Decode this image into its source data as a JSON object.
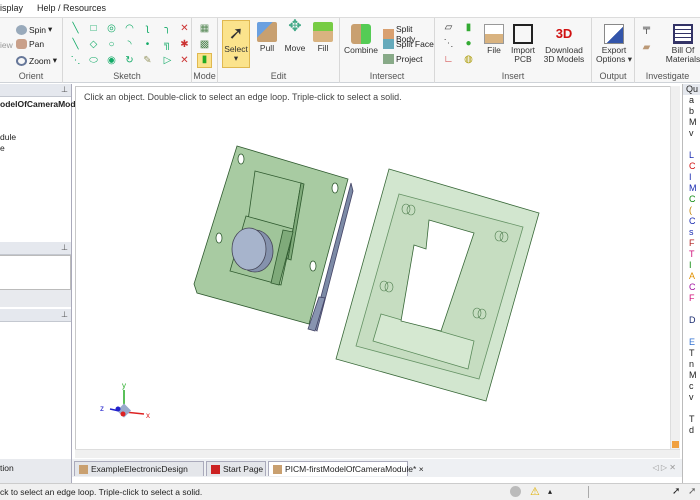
{
  "menu": {
    "items": [
      "isplay",
      "Help / Resources"
    ]
  },
  "ribbon": {
    "orient": {
      "label": "Orient",
      "spin": "Spin",
      "pan": "Pan",
      "zoom": "Zoom",
      "view": "iew"
    },
    "sketch": {
      "label": "Sketch"
    },
    "mode": {
      "label": "Mode"
    },
    "edit": {
      "label": "Edit",
      "select": "Select",
      "pull": "Pull",
      "move": "Move",
      "fill": "Fill"
    },
    "intersect": {
      "label": "Intersect",
      "combine": "Combine",
      "split_body": "Split Body",
      "split_face": "Split Face",
      "project": "Project"
    },
    "insert": {
      "label": "Insert",
      "file": "File",
      "import_pcb": "Import PCB",
      "download_3d": "Download 3D Models",
      "logo_3d": "3D"
    },
    "output": {
      "label": "Output",
      "export_options": "Export Options"
    },
    "investigate": {
      "label": "Investigate",
      "bom": "Bill Of Materials"
    }
  },
  "left_panel": {
    "tree_root": "odelOfCameraModul",
    "tree_items": [
      "dule",
      "e"
    ],
    "bottom_label": "tion"
  },
  "viewport": {
    "hint": "Click an object. Double-click to select an edge loop. Triple-click to select a solid.",
    "axes": {
      "x": "x",
      "y": "y",
      "z": "z"
    }
  },
  "right_panel": {
    "header": "Qu",
    "lines": [
      {
        "t": "a",
        "c": "#222"
      },
      {
        "t": "b",
        "c": "#222"
      },
      {
        "t": "M",
        "c": "#222"
      },
      {
        "t": "v",
        "c": "#222"
      },
      {
        "t": "",
        "c": "#222"
      },
      {
        "t": "L",
        "c": "#1a2bb0"
      },
      {
        "t": "C",
        "c": "#d01010"
      },
      {
        "t": "I",
        "c": "#1a2bb0"
      },
      {
        "t": "M",
        "c": "#1a2bb0"
      },
      {
        "t": "C",
        "c": "#108a10"
      },
      {
        "t": "(",
        "c": "#c08000"
      },
      {
        "t": "C",
        "c": "#1a2bb0"
      },
      {
        "t": "s",
        "c": "#1a2bb0"
      },
      {
        "t": "F",
        "c": "#b02020"
      },
      {
        "t": "T",
        "c": "#d0107a"
      },
      {
        "t": "I",
        "c": "#108a10"
      },
      {
        "t": "A",
        "c": "#e09000"
      },
      {
        "t": "C",
        "c": "#a010a0"
      },
      {
        "t": "F",
        "c": "#d0107a"
      },
      {
        "t": "",
        "c": "#222"
      },
      {
        "t": "D",
        "c": "#1a2b70"
      },
      {
        "t": "",
        "c": "#222"
      },
      {
        "t": "E",
        "c": "#3070d0"
      },
      {
        "t": "T",
        "c": "#222"
      },
      {
        "t": "n",
        "c": "#222"
      },
      {
        "t": "M",
        "c": "#222"
      },
      {
        "t": "c",
        "c": "#222"
      },
      {
        "t": "v",
        "c": "#222"
      },
      {
        "t": "",
        "c": "#222"
      },
      {
        "t": "T",
        "c": "#222"
      },
      {
        "t": "d",
        "c": "#222"
      }
    ]
  },
  "tabs": [
    {
      "label": "ExampleElectronicDesign",
      "active": false
    },
    {
      "label": "Start Page",
      "active": false
    },
    {
      "label": "PICM-firstModelOfCameraModule*",
      "active": true
    }
  ],
  "tab_close": "×",
  "status": {
    "text": "ck to select an edge loop. Triple-click to select a solid."
  },
  "colors": {
    "accent": "#fbe38c",
    "model_green": "#a6c9a0",
    "lens": "#a7b4cc"
  }
}
